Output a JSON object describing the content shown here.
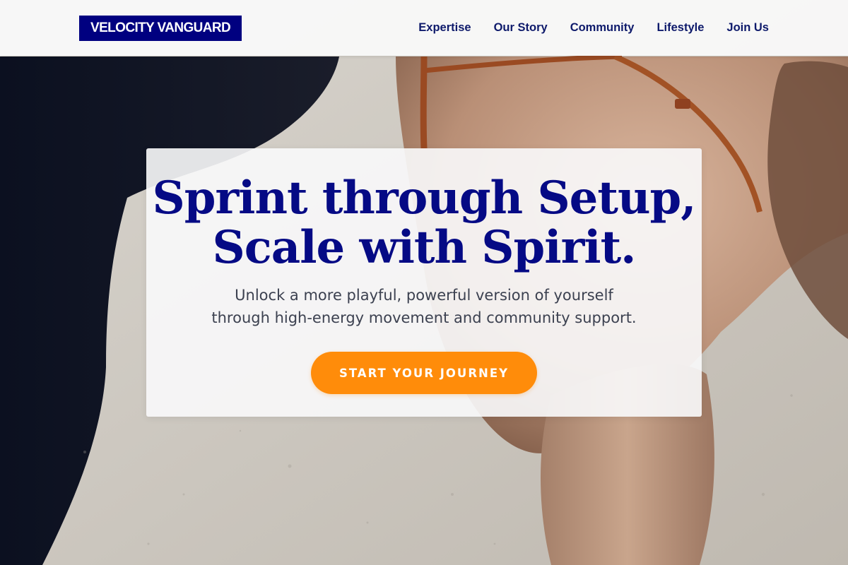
{
  "brand": {
    "name": "VELOCITY VANGUARD"
  },
  "nav": {
    "items": [
      {
        "label": "Expertise"
      },
      {
        "label": "Our Story"
      },
      {
        "label": "Community"
      },
      {
        "label": "Lifestyle"
      },
      {
        "label": "Join Us"
      }
    ]
  },
  "hero": {
    "title_lines": [
      "Sprint through Setup,",
      "Scale with Spirit."
    ],
    "subtitle_lines": [
      "Unlock a more playful, powerful version of yourself",
      "through high-energy movement and community support."
    ],
    "cta_label": "START YOUR JOURNEY"
  },
  "colors": {
    "brand_navy": "#000080",
    "headline_blue": "#050a85",
    "accent_orange": "#ff8c0a",
    "nav_text": "#0e1a6b"
  }
}
